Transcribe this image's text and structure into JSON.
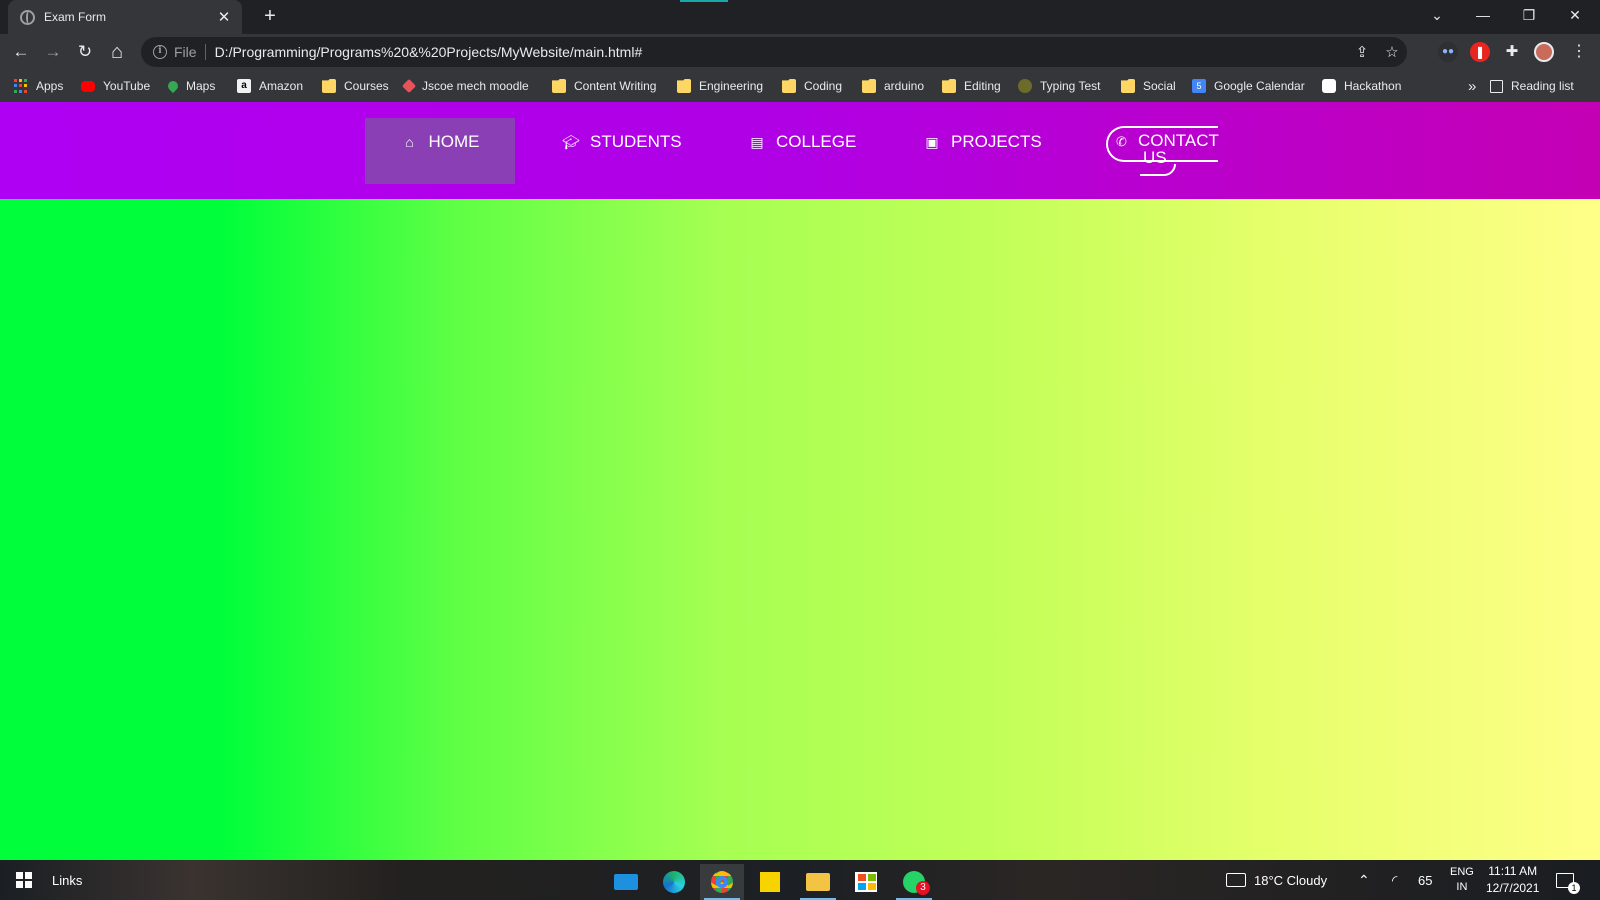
{
  "browser": {
    "tab": {
      "title": "Exam Form",
      "close": "✕"
    },
    "new_tab": "+",
    "window_controls": {
      "tablist": "⌄",
      "minimize": "—",
      "restore": "❐",
      "close": "✕"
    },
    "nav": {
      "back": "←",
      "forward": "→",
      "reload": "↻",
      "home": "⌂"
    },
    "address": {
      "scheme": "File",
      "url": "D:/Programming/Programs%20&%20Projects/MyWebsite/main.html#",
      "share_icon": "⇪",
      "star_icon": "☆"
    },
    "menu": "⋮"
  },
  "bookmarks": {
    "items": [
      {
        "label": "Apps",
        "icon": "apps-grid"
      },
      {
        "label": "YouTube",
        "icon": "youtube"
      },
      {
        "label": "Maps",
        "icon": "maps"
      },
      {
        "label": "Amazon",
        "icon": "amazon"
      },
      {
        "label": "Courses",
        "icon": "folder"
      },
      {
        "label": "Jscoe mech moodle",
        "icon": "moodle"
      },
      {
        "label": "Content Writing",
        "icon": "folder"
      },
      {
        "label": "Engineering",
        "icon": "folder"
      },
      {
        "label": "Coding",
        "icon": "folder"
      },
      {
        "label": "arduino",
        "icon": "folder"
      },
      {
        "label": "Editing",
        "icon": "folder"
      },
      {
        "label": "Typing Test",
        "icon": "typing"
      },
      {
        "label": "Social",
        "icon": "folder"
      },
      {
        "label": "Google Calendar",
        "icon": "calendar"
      },
      {
        "label": "Hackathon",
        "icon": "hackathon"
      }
    ],
    "overflow": "»",
    "reading_list": "Reading list"
  },
  "site": {
    "nav": [
      {
        "label": "HOME",
        "icon": "home-icon",
        "active": true
      },
      {
        "label": "STUDENTS",
        "icon": "graduation-cap-icon"
      },
      {
        "label": "COLLEGE",
        "icon": "building-icon"
      },
      {
        "label": "PROJECTS",
        "icon": "camera-icon"
      },
      {
        "label": "CONTACT US",
        "icon": "phone-icon"
      }
    ],
    "contact_line1": "CONTACT",
    "contact_line2": "US"
  },
  "taskbar": {
    "search_label": "Links",
    "weather": "18°C  Cloudy",
    "battery": "65",
    "lang_line1": "ENG",
    "lang_line2": "IN",
    "time": "11:11 AM",
    "date": "12/7/2021",
    "whatsapp_badge": "3",
    "notification_badge": "1"
  },
  "colors": {
    "navbar": "#b000f4",
    "nav_active": "#8a3fb4",
    "page_left": "#00ff3a",
    "page_right": "#ffff88"
  }
}
